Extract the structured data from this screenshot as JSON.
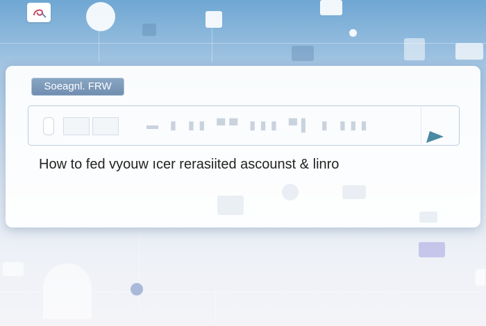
{
  "brand": {
    "icon": "swirl-logo-icon"
  },
  "search_label": "Soeagnl. FRW",
  "search": {
    "placeholder": "▬  ▮ ▮▮  ▀▀  ▮▮▮  ▀▌ ▮ ▮▮▮",
    "submit_icon": "arrow-submit-icon"
  },
  "headline": "How to fed vyouw ıcer rerasiited ascounst  &  linro",
  "colors": {
    "accent": "#4a8aa3",
    "chip": "#7d9aba"
  }
}
